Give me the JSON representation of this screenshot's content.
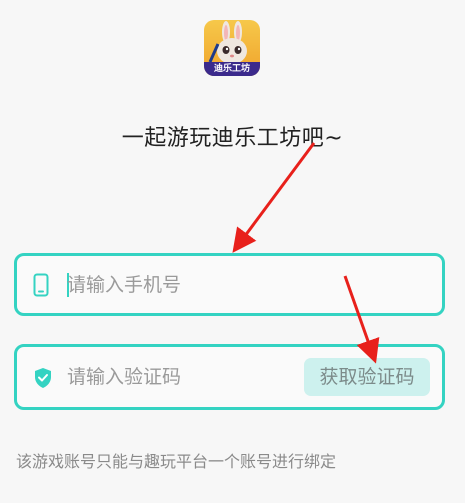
{
  "app": {
    "icon": "app-logo-icon",
    "icon_label": "迪乐工坊"
  },
  "heading": "一起游玩迪乐工坊吧~",
  "phone": {
    "icon": "phone-icon",
    "placeholder": "请输入手机号"
  },
  "code": {
    "icon": "shield-check-icon",
    "placeholder": "请输入验证码",
    "button_label": "获取验证码"
  },
  "notice": "该游戏账号只能与趣玩平台一个账号进行绑定",
  "colors": {
    "accent": "#34d3c2",
    "button_bg": "#cdf1ee",
    "annotation": "#e8201b"
  }
}
